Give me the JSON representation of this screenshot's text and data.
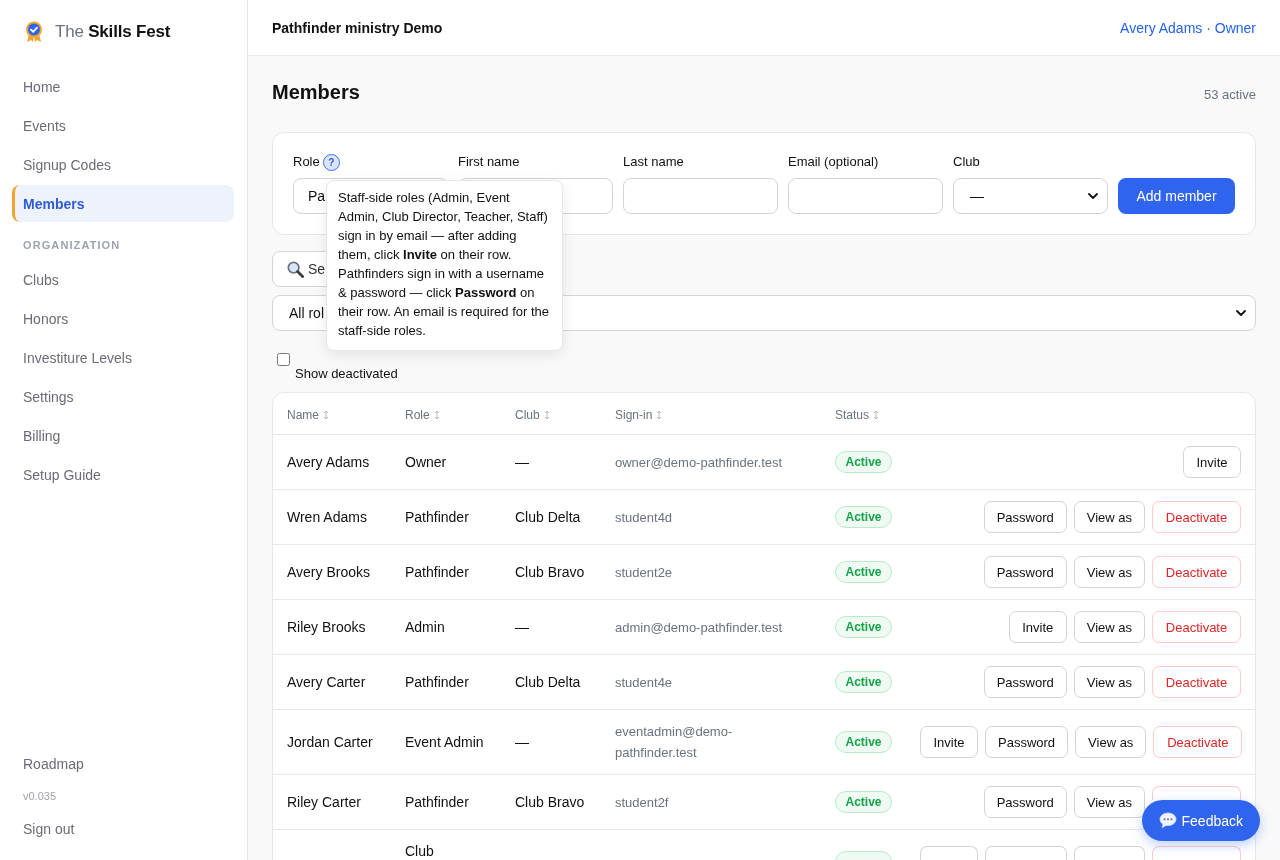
{
  "sidebar": {
    "brand": "The **Skills Fest**",
    "nav_groups": [
      {
        "items": [
          {
            "label": "Home",
            "selected": false
          },
          {
            "label": "Events",
            "selected": false
          },
          {
            "label": "Signup Codes",
            "selected": false
          },
          {
            "label": "Members",
            "selected": true
          }
        ]
      },
      {
        "heading": "ORGANIZATION",
        "items": [
          {
            "label": "Clubs",
            "selected": false
          },
          {
            "label": "Honors",
            "selected": false
          },
          {
            "label": "Investiture Levels",
            "selected": false
          },
          {
            "label": "Settings",
            "selected": false
          },
          {
            "label": "Billing",
            "selected": false
          },
          {
            "label": "Setup Guide",
            "selected": false
          }
        ]
      }
    ],
    "footer": {
      "roadmap": "Roadmap",
      "version": "v0.035",
      "sign_out": "Sign out"
    }
  },
  "header": {
    "workspace": "Pathfinder ministry Demo",
    "account": "Avery Adams · Owner"
  },
  "page": {
    "title": "Members",
    "count": "53 active"
  },
  "add_form": {
    "fields": [
      {
        "label": "Role",
        "help": "?",
        "tooltip": "Staff-side roles (Admin, Event Admin, Club Director, Teacher, Staff) sign in by email — after adding them, click **Invite** on their row. Pathfinders sign in with a username & password — click **Password** on their row. An email is required for the staff-side roles.",
        "kind": "input",
        "value": "Pa"
      },
      {
        "label": "First name",
        "kind": "input"
      },
      {
        "label": "Last name",
        "kind": "input"
      },
      {
        "label": "Email (optional)",
        "kind": "input"
      },
      {
        "label": "Club",
        "kind": "select",
        "value": "—"
      }
    ],
    "submit": "Add member"
  },
  "filters": {
    "search": {
      "placeholder": "Se"
    },
    "role_filter": {
      "value": "All rol"
    },
    "show_deactivated": {
      "label": "Show deactivated",
      "checked": false
    }
  },
  "table": {
    "columns": [
      {
        "label": "Name"
      },
      {
        "label": "Role"
      },
      {
        "label": "Club"
      },
      {
        "label": "Sign-in"
      },
      {
        "label": "Status"
      }
    ],
    "rows": [
      {
        "name": "Avery Adams",
        "role": "Owner",
        "club": "—",
        "sign_in": "owner@demo-pathfinder.test",
        "status": {
          "kind": "active",
          "label": "Active"
        },
        "actions": [
          {
            "kind": "invite",
            "label": "Invite"
          }
        ]
      },
      {
        "name": "Wren Adams",
        "role": "Pathfinder",
        "club": "Club Delta",
        "sign_in": "student4d",
        "status": {
          "kind": "active",
          "label": "Active"
        },
        "actions": [
          {
            "kind": "password",
            "label": "Password"
          },
          {
            "kind": "view_as",
            "label": "View as"
          },
          {
            "kind": "deactivate",
            "label": "Deactivate"
          }
        ]
      },
      {
        "name": "Avery Brooks",
        "role": "Pathfinder",
        "club": "Club Bravo",
        "sign_in": "student2e",
        "status": {
          "kind": "active",
          "label": "Active"
        },
        "actions": [
          {
            "kind": "password",
            "label": "Password"
          },
          {
            "kind": "view_as",
            "label": "View as"
          },
          {
            "kind": "deactivate",
            "label": "Deactivate"
          }
        ]
      },
      {
        "name": "Riley Brooks",
        "role": "Admin",
        "club": "—",
        "sign_in": "admin@demo-pathfinder.test",
        "status": {
          "kind": "active",
          "label": "Active"
        },
        "actions": [
          {
            "kind": "invite",
            "label": "Invite"
          },
          {
            "kind": "view_as",
            "label": "View as"
          },
          {
            "kind": "deactivate",
            "label": "Deactivate"
          }
        ]
      },
      {
        "name": "Avery Carter",
        "role": "Pathfinder",
        "club": "Club Delta",
        "sign_in": "student4e",
        "status": {
          "kind": "active",
          "label": "Active"
        },
        "actions": [
          {
            "kind": "password",
            "label": "Password"
          },
          {
            "kind": "view_as",
            "label": "View as"
          },
          {
            "kind": "deactivate",
            "label": "Deactivate"
          }
        ]
      },
      {
        "name": "Jordan Carter",
        "role": "Event Admin",
        "club": "—",
        "sign_in": "eventadmin@demo-pathfinder.test",
        "status": {
          "kind": "active",
          "label": "Active"
        },
        "actions": [
          {
            "kind": "invite",
            "label": "Invite"
          },
          {
            "kind": "password",
            "label": "Password"
          },
          {
            "kind": "view_as",
            "label": "View as"
          },
          {
            "kind": "deactivate",
            "label": "Deactivate"
          }
        ]
      },
      {
        "name": "Riley Carter",
        "role": "Pathfinder",
        "club": "Club Bravo",
        "sign_in": "student2f",
        "status": {
          "kind": "active",
          "label": "Active"
        },
        "actions": [
          {
            "kind": "password",
            "label": "Password"
          },
          {
            "kind": "view_as",
            "label": "View as"
          },
          {
            "kind": "deactivate"
          }
        ]
      },
      {
        "role": "Club",
        "status": {
          "kind": "active"
        },
        "actions": [
          {
            "kind": "invite"
          },
          {
            "kind": "password"
          },
          {
            "kind": "view_as"
          },
          {
            "kind": "deactivate"
          }
        ]
      }
    ]
  },
  "feedback": {
    "label": "Feedback"
  }
}
